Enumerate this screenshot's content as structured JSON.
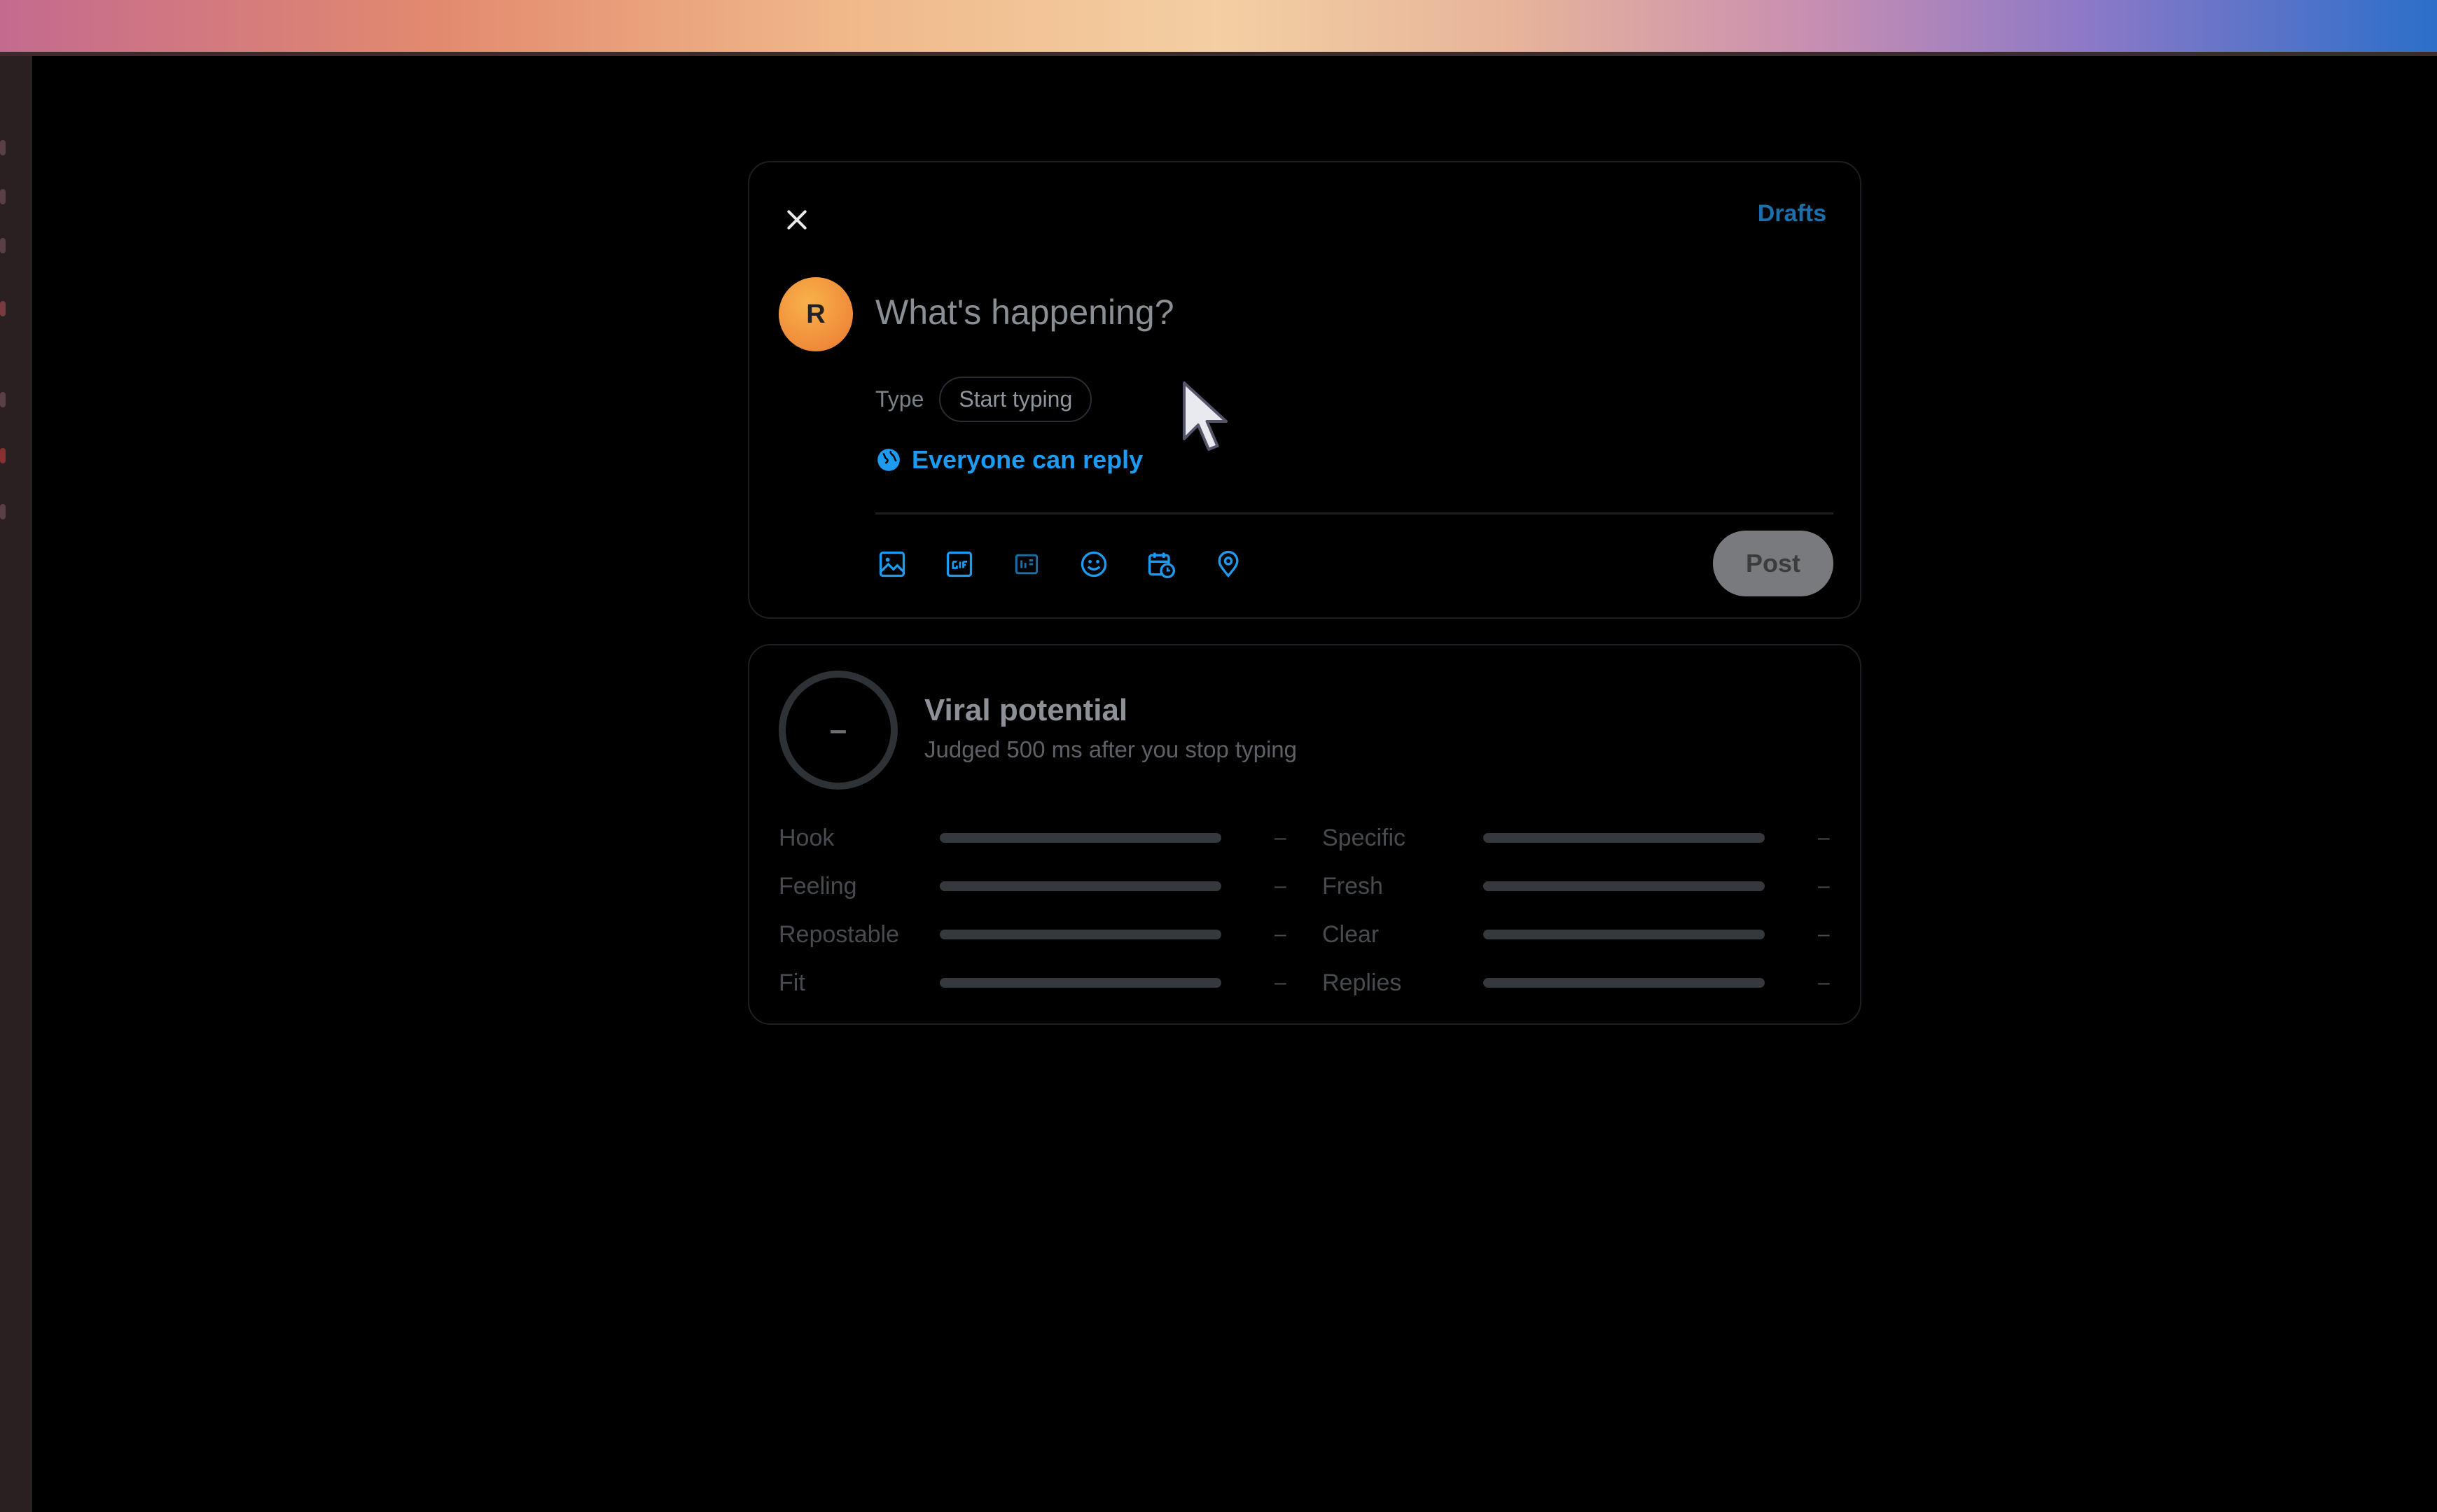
{
  "composer": {
    "drafts_label": "Drafts",
    "avatar_initial": "R",
    "placeholder": "What's happening?",
    "type_label": "Type",
    "type_pill": "Start typing",
    "reply_setting": "Everyone can reply",
    "post_label": "Post",
    "tools": [
      "image-icon",
      "gif-icon",
      "poll-icon",
      "emoji-icon",
      "schedule-icon",
      "location-icon"
    ]
  },
  "viral": {
    "score": "–",
    "title": "Viral potential",
    "subtitle": "Judged 500 ms after you stop typing",
    "metrics_left": [
      {
        "label": "Hook",
        "value": "–",
        "level": 0
      },
      {
        "label": "Feeling",
        "value": "–",
        "level": 0
      },
      {
        "label": "Repostable",
        "value": "–",
        "level": 0
      },
      {
        "label": "Fit",
        "value": "–",
        "level": 0
      }
    ],
    "metrics_right": [
      {
        "label": "Specific",
        "value": "–",
        "level": 0
      },
      {
        "label": "Fresh",
        "value": "–",
        "level": 0
      },
      {
        "label": "Clear",
        "value": "–",
        "level": 0
      },
      {
        "label": "Replies",
        "value": "–",
        "level": 0
      }
    ]
  },
  "colors": {
    "accent": "#1d9bf0",
    "background": "#000000",
    "post_button": "#787a7d"
  }
}
